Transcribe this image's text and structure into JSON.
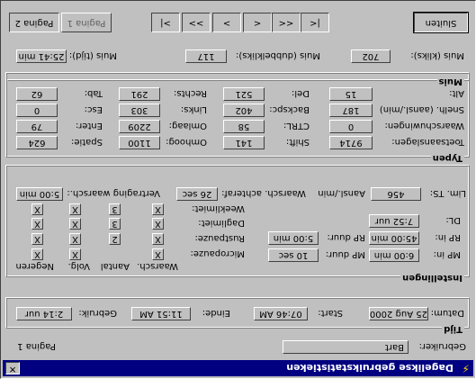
{
  "window": {
    "title": "Dagelikse gebruikstatistieken",
    "close_glyph": "✕",
    "title_icon": "lightning-icon"
  },
  "user_bar": {
    "user_label": "Gebruiker:",
    "user_value": "Bart",
    "page_label": "Pagina 1"
  },
  "time": {
    "title": "Tijd",
    "date_label": "Datum:",
    "date_value": "25 Aug 2000",
    "start_label": "Start:",
    "start_value": "07:46 AM",
    "end_label": "Einde:",
    "end_value": "11:51 AM",
    "usage_label": "Gebruik:",
    "usage_value": "2:14 uur"
  },
  "settings": {
    "title": "Instellingen",
    "mp_in_label": "MP in:",
    "mp_in_value": "6:00 min",
    "mp_dur_label": "MP duur:",
    "mp_dur_value": "10 sec",
    "rp_in_label": "RP in:",
    "rp_in_value": "45:00 min",
    "rp_dur_label": "RP duur:",
    "rp_dur_value": "5:00 min",
    "dl_label": "DL:",
    "dl_value": "7:52 uur",
    "lim_ts_label": "Lim. TS:",
    "lim_ts_value": "456",
    "lim_ts_unit": "Aansl./min",
    "warn_delay_label": "Waarsch. achteraf:",
    "warn_delay_value": "26 sec",
    "warn_delay2_label": "Vertraging waarsch.:",
    "warn_delay2_value": "5:00 min",
    "col_headers": [
      "Waarsch.",
      "Aantal",
      "Volg.",
      "Negeren"
    ],
    "rows": [
      {
        "label": "Micropauze:",
        "warn": "X",
        "count": "",
        "follow": "X",
        "ignore": "X"
      },
      {
        "label": "Rustpauze:",
        "warn": "X",
        "count": "2",
        "follow": "X",
        "ignore": "X"
      },
      {
        "label": "Daglimiet:",
        "warn": "X",
        "count": "3",
        "follow": "X",
        "ignore": "X"
      },
      {
        "label": "Weeklimiet:",
        "warn": "X",
        "count": "3",
        "follow": "X",
        "ignore": "X"
      }
    ]
  },
  "keys": {
    "title": "Typen",
    "keystrokes_label": "Toetsaanslagen:",
    "keystrokes_value": "9714",
    "shift_label": "Shift:",
    "shift_value": "141",
    "up_label": "Omhoog:",
    "up_value": "1100",
    "space_label": "Spatie:",
    "space_value": "624",
    "warnings_label": "Waarschuwingen:",
    "warnings_value": "0",
    "ctrl_label": "CTRL:",
    "ctrl_value": "58",
    "down_label": "Omlaag:",
    "down_value": "2209",
    "enter_label": "Enter:",
    "enter_value": "79",
    "speed_label": "Snelh. (aansl./min)",
    "speed_value": "187",
    "backspace_label": "Backspc:",
    "backspace_value": "402",
    "left_label": "Links:",
    "left_value": "303",
    "esc_label": "Esc:",
    "esc_value": "0",
    "alt_label": "Alt:",
    "alt_value": "15",
    "del_label": "Del:",
    "del_value": "521",
    "right_label": "Rechts:",
    "right_value": "291",
    "tab_label": "Tab:",
    "tab_value": "62"
  },
  "mouse": {
    "title": "Muis",
    "clicks_label": "Muis (kliks):",
    "clicks_value": "702",
    "dbl_label": "Muis (dubbelkliks):",
    "dbl_value": "117",
    "time_label": "Muis (tijd):",
    "time_value": "25:41 min"
  },
  "toolbar": {
    "close_label": "Sluiten",
    "nav": [
      "|<",
      "<<",
      "<",
      ">",
      ">>",
      ">|"
    ],
    "tab_page1": "Pagina 1",
    "tab_page2": "Pagina 2"
  }
}
